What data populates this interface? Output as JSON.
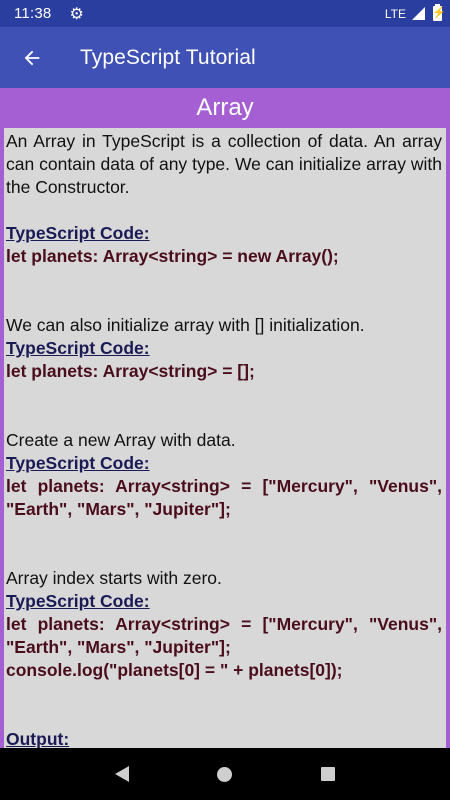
{
  "status_bar": {
    "time": "11:38",
    "network": "LTE",
    "icons": [
      "gear-icon",
      "signal-icon",
      "battery-charging-icon"
    ]
  },
  "app_bar": {
    "title": "TypeScript Tutorial",
    "back_icon": "arrow-back-icon",
    "color": "#3f51b5"
  },
  "section": {
    "title": "Array",
    "color": "#a55fd3"
  },
  "content": {
    "intro": "An Array in TypeScript is a collection of data. An array can contain data of any type. We can initialize array with the Constructor.",
    "code_label": "TypeScript Code:",
    "code1": "let planets: Array<string> = new Array();",
    "para2": "We can also initialize array with [] initialization.",
    "code2": "let planets: Array<string> = [];",
    "para3": "Create a new Array with data.",
    "code3": "let planets: Array<string> = [\"Mercury\", \"Venus\", \"Earth\", \"Mars\", \"Jupiter\"];",
    "para4": "Array index starts with zero.",
    "code4_line1": "let planets: Array<string> = [\"Mercury\", \"Venus\", \"Earth\", \"Mars\", \"Jupiter\"];",
    "code4_line2": "console.log(\"planets[0] = \" + planets[0]);",
    "output_label": "Output:"
  },
  "nav_bar": {
    "buttons": [
      "back-icon",
      "home-icon",
      "recents-icon"
    ]
  }
}
